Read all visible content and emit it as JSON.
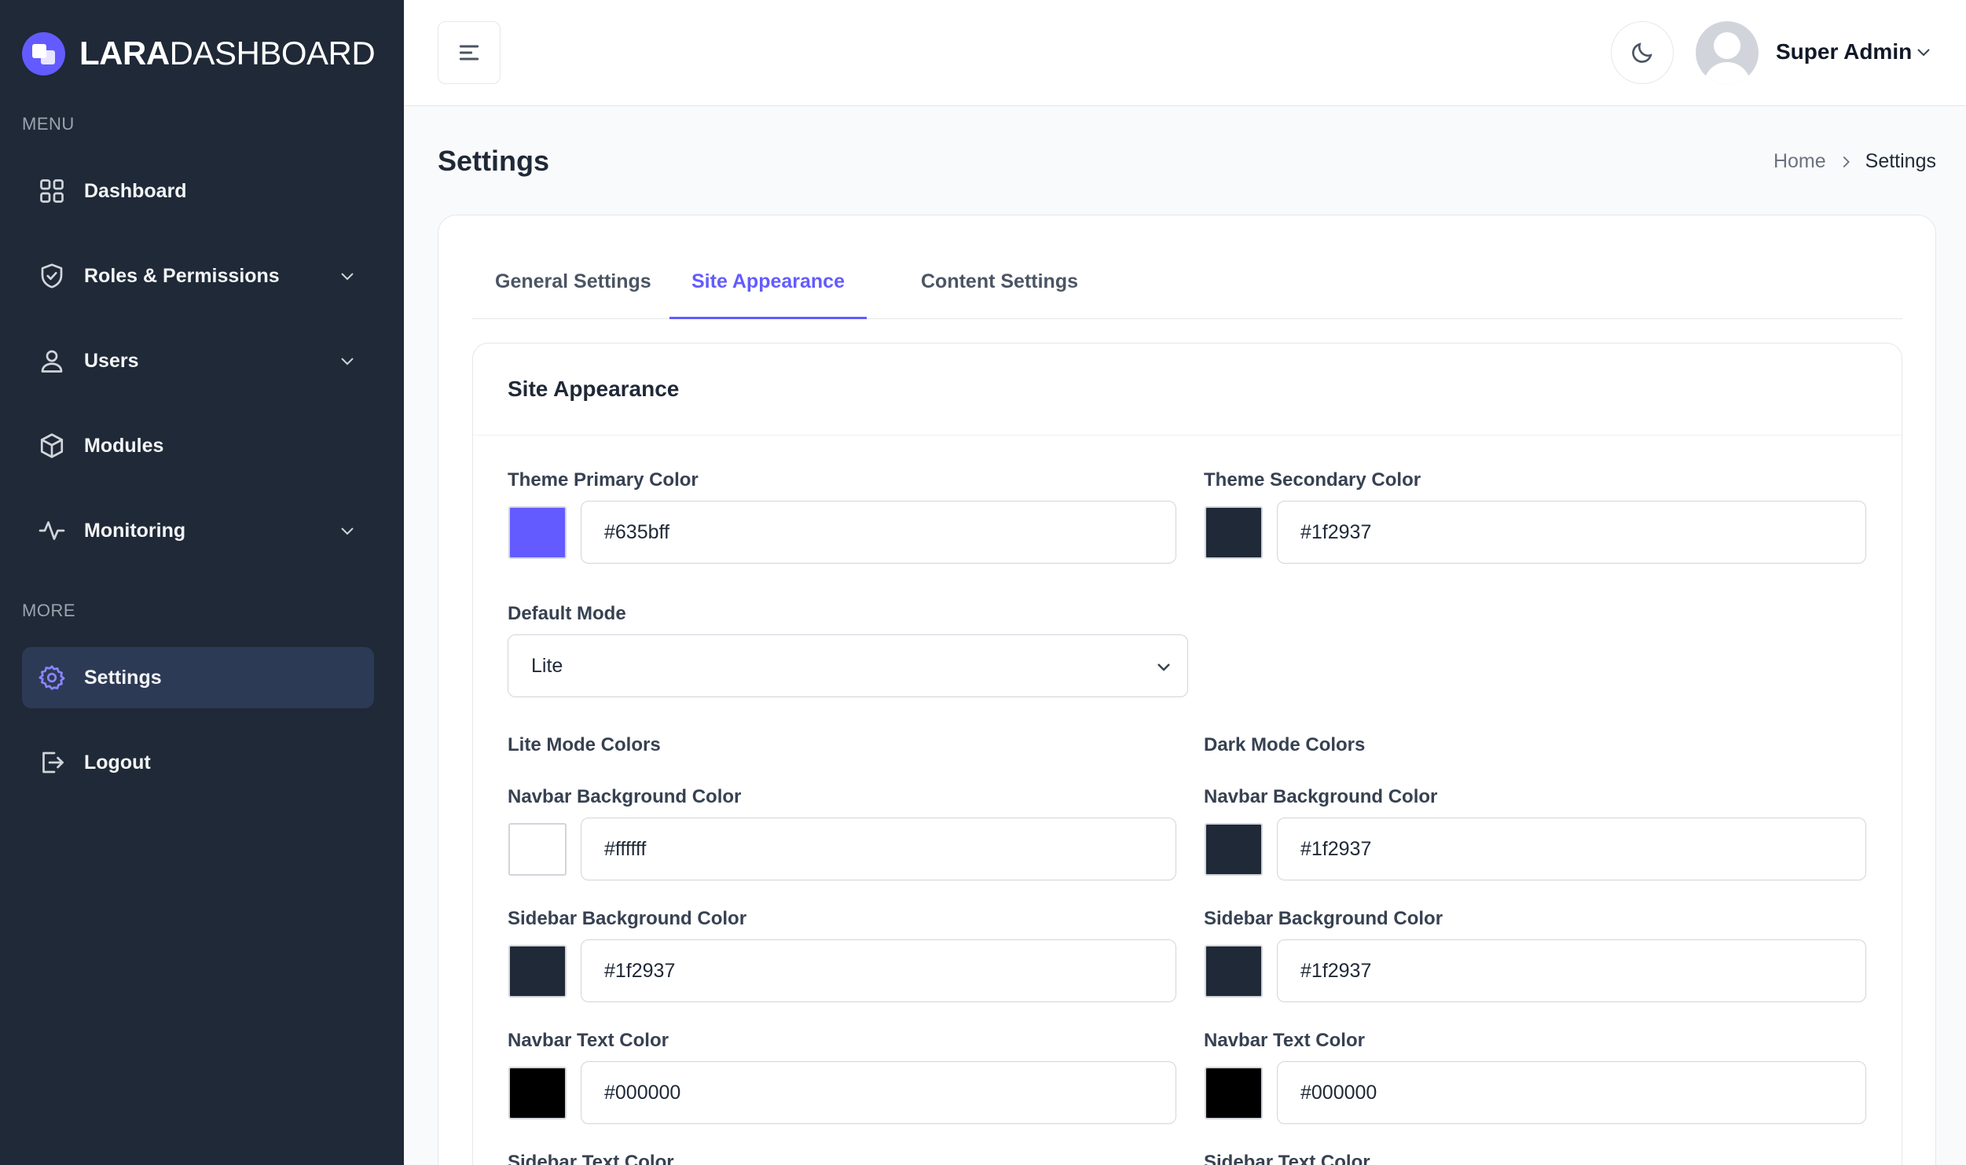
{
  "brand": {
    "bold": "LARA",
    "light": "DASHBOARD"
  },
  "sidebar": {
    "menu_label": "MENU",
    "more_label": "MORE",
    "items": [
      {
        "label": "Dashboard"
      },
      {
        "label": "Roles & Permissions"
      },
      {
        "label": "Users"
      },
      {
        "label": "Modules"
      },
      {
        "label": "Monitoring"
      },
      {
        "label": "Settings"
      },
      {
        "label": "Logout"
      }
    ]
  },
  "header": {
    "user_name": "Super Admin"
  },
  "page": {
    "title": "Settings",
    "breadcrumb": {
      "home": "Home",
      "current": "Settings"
    }
  },
  "tabs": [
    {
      "label": "General Settings"
    },
    {
      "label": "Site Appearance"
    },
    {
      "label": "Content Settings"
    }
  ],
  "appearance": {
    "heading": "Site Appearance",
    "primary": {
      "label": "Theme Primary Color",
      "value": "#635bff"
    },
    "secondary": {
      "label": "Theme Secondary Color",
      "value": "#1f2937"
    },
    "default_mode": {
      "label": "Default Mode",
      "value": "Lite"
    },
    "lite": {
      "heading": "Lite Mode Colors",
      "navbar_bg": {
        "label": "Navbar Background Color",
        "value": "#ffffff"
      },
      "sidebar_bg": {
        "label": "Sidebar Background Color",
        "value": "#1f2937"
      },
      "navbar_text": {
        "label": "Navbar Text Color",
        "value": "#000000"
      },
      "sidebar_text": {
        "label": "Sidebar Text Color"
      }
    },
    "dark": {
      "heading": "Dark Mode Colors",
      "navbar_bg": {
        "label": "Navbar Background Color",
        "value": "#1f2937"
      },
      "sidebar_bg": {
        "label": "Sidebar Background Color",
        "value": "#1f2937"
      },
      "navbar_text": {
        "label": "Navbar Text Color",
        "value": "#000000"
      },
      "sidebar_text": {
        "label": "Sidebar Text Color"
      }
    }
  },
  "colors": {
    "accent": "#635bff",
    "sidebar": "#1f2937",
    "active_item": "#2d3a55"
  }
}
